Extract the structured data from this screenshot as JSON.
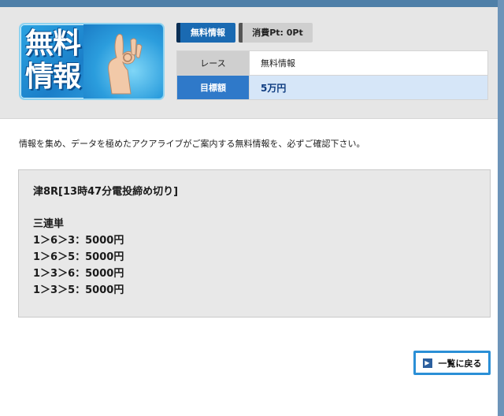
{
  "banner": {
    "line1": "無料",
    "line2": "情報",
    "image": "ok-hand-in-water-icon"
  },
  "tags": {
    "free_label": "無料情報",
    "points_label": "消費Pt: 0Pt"
  },
  "info": {
    "race_key": "レース",
    "race_value": "無料情報",
    "target_key": "目標額",
    "target_value": "5万円"
  },
  "intro_text": "情報を集め、データを極めたアクアライブがご案内する無料情報を、必ずご確認下さい。",
  "result": {
    "race": "津8R[13時47分電投締め切り]",
    "bet_type": "三連単",
    "lines": [
      "1＞6＞3：5000円",
      "1＞6＞5：5000円",
      "1＞3＞6：5000円",
      "1＞3＞5：5000円"
    ]
  },
  "back_button": {
    "label": "一覧に戻る",
    "icon": "chevron-right-icon"
  },
  "colors": {
    "accent": "#2f79c9",
    "tag_dark": "#1a6ab2",
    "target_bg": "#d6e6f8"
  }
}
